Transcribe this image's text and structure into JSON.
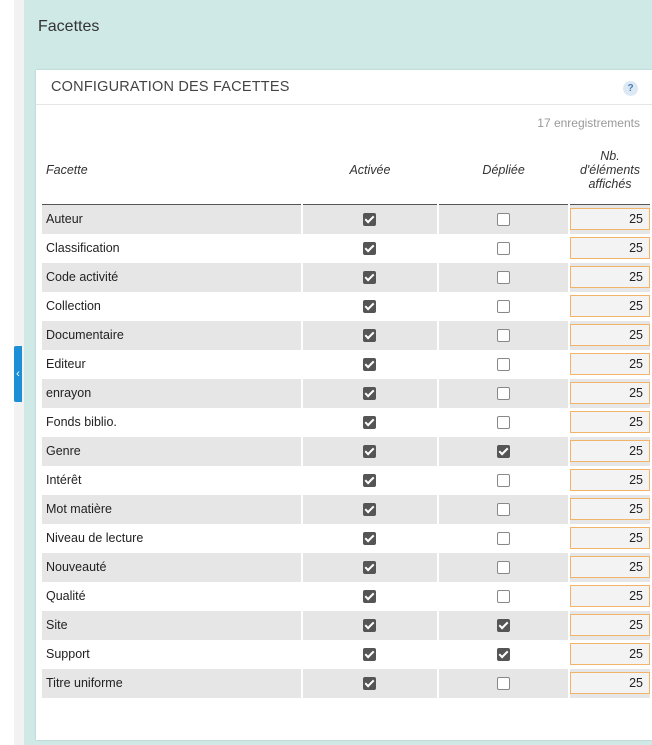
{
  "page": {
    "title": "Facettes"
  },
  "panel": {
    "title": "CONFIGURATION DES FACETTES",
    "help_symbol": "?",
    "records": "17 enregistrements"
  },
  "table": {
    "headers": {
      "facet": "Facette",
      "enabled": "Activée",
      "expanded": "Dépliée",
      "count": [
        "Nb.",
        "d'éléments",
        "affichés"
      ]
    },
    "rows": [
      {
        "name": "Auteur",
        "enabled": true,
        "expanded": false,
        "count": "25"
      },
      {
        "name": "Classification",
        "enabled": true,
        "expanded": false,
        "count": "25"
      },
      {
        "name": "Code activité",
        "enabled": true,
        "expanded": false,
        "count": "25"
      },
      {
        "name": "Collection",
        "enabled": true,
        "expanded": false,
        "count": "25"
      },
      {
        "name": "Documentaire",
        "enabled": true,
        "expanded": false,
        "count": "25"
      },
      {
        "name": "Editeur",
        "enabled": true,
        "expanded": false,
        "count": "25"
      },
      {
        "name": "enrayon",
        "enabled": true,
        "expanded": false,
        "count": "25"
      },
      {
        "name": "Fonds biblio.",
        "enabled": true,
        "expanded": false,
        "count": "25"
      },
      {
        "name": "Genre",
        "enabled": true,
        "expanded": true,
        "count": "25"
      },
      {
        "name": "Intérêt",
        "enabled": true,
        "expanded": false,
        "count": "25"
      },
      {
        "name": "Mot matière",
        "enabled": true,
        "expanded": false,
        "count": "25"
      },
      {
        "name": "Niveau de lecture",
        "enabled": true,
        "expanded": false,
        "count": "25"
      },
      {
        "name": "Nouveauté",
        "enabled": true,
        "expanded": false,
        "count": "25"
      },
      {
        "name": "Qualité",
        "enabled": true,
        "expanded": false,
        "count": "25"
      },
      {
        "name": "Site",
        "enabled": true,
        "expanded": true,
        "count": "25"
      },
      {
        "name": "Support",
        "enabled": true,
        "expanded": true,
        "count": "25"
      },
      {
        "name": "Titre uniforme",
        "enabled": true,
        "expanded": false,
        "count": "25"
      }
    ]
  },
  "sidebar": {
    "collapse_symbol": "‹"
  },
  "colors": {
    "accent": "#1d8fd6",
    "background": "#cfe9e6",
    "input_border": "#f2b36b",
    "checkbox_checked": "#555555"
  }
}
